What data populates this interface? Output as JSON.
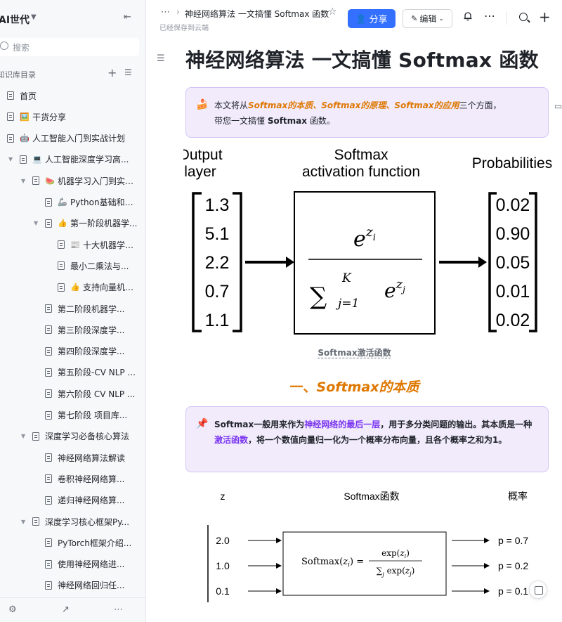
{
  "sidebar": {
    "title": "AI世代",
    "search_placeholder": "搜索",
    "section_label": "知识库目录",
    "items": [
      {
        "label": "首页",
        "emoji": ""
      },
      {
        "label": "干货分享",
        "emoji": "🖼️"
      },
      {
        "label": "人工智能入门到实战计划",
        "emoji": "🤖"
      },
      {
        "label": "人工智能深度学习高...",
        "emoji": "💻"
      },
      {
        "label": "机器学习入门到实战...",
        "emoji": "🍉"
      },
      {
        "label": "Python基础和数...",
        "emoji": "🦾"
      },
      {
        "label": "第一阶段机器学...",
        "emoji": "👍"
      },
      {
        "label": "十大机器学习...",
        "emoji": "📰"
      },
      {
        "label": "最小二乘法与...",
        "emoji": ""
      },
      {
        "label": "支持向量机算...",
        "emoji": "👍"
      },
      {
        "label": "第二阶段机器学...",
        "emoji": ""
      },
      {
        "label": "第三阶段深度学...",
        "emoji": ""
      },
      {
        "label": "第四阶段深度学...",
        "emoji": ""
      },
      {
        "label": "第五阶段-CV NLP ...",
        "emoji": ""
      },
      {
        "label": "第六阶段 CV NLP ...",
        "emoji": ""
      },
      {
        "label": "第七阶段 项目库...",
        "emoji": ""
      },
      {
        "label": "深度学习必备核心算法",
        "emoji": ""
      },
      {
        "label": "神经网络算法解读",
        "emoji": ""
      },
      {
        "label": "卷积神经网络算...",
        "emoji": ""
      },
      {
        "label": "递归神经网络算...",
        "emoji": ""
      },
      {
        "label": "深度学习核心框架Py...",
        "emoji": ""
      },
      {
        "label": "PyTorch框架介绍...",
        "emoji": ""
      },
      {
        "label": "使用神经网络进...",
        "emoji": ""
      },
      {
        "label": "神经网络回归任...",
        "emoji": ""
      }
    ]
  },
  "topbar": {
    "breadcrumb_title": "神经网络算法 一文搞懂 Softmax 函数",
    "saved_status": "已经保存到云端",
    "share_label": "分享",
    "edit_label": "编辑"
  },
  "doc": {
    "title": "神经网络算法 一文搞懂 Softmax 函数",
    "callout1": {
      "icon": "🍰",
      "pre": "本文将从",
      "highlight": "Softmax的本质、Softmax的原理、Softmax的应用",
      "post": "三个方面，",
      "line2_pre": "带您一文搞懂 ",
      "line2_bold": "Softmax",
      "line2_post": " 函数。"
    },
    "figure1": {
      "left_title_1": "Output",
      "left_title_2": "layer",
      "mid_title_1": "Softmax",
      "mid_title_2": "activation function",
      "right_title": "Probabilities",
      "inputs": [
        "1.3",
        "5.1",
        "2.2",
        "0.7",
        "1.1"
      ],
      "outputs": [
        "0.02",
        "0.90",
        "0.05",
        "0.01",
        "0.02"
      ]
    },
    "figure1_caption": "Softmax激活函数",
    "heading1_prefix": "一、",
    "heading1_main": "Softmax的本质",
    "callout2": {
      "icon": "📌",
      "p1": "Softmax一般用来作为",
      "p1_link": "神经网络的最后一层",
      "p2": "，用于多分类问题的输出。其本质是一种",
      "p2_link": "激活函数",
      "p3": "，将一个数值向量归一化为一个概率分布向量，且各个概率之和为1。"
    },
    "figure2": {
      "col_z": "z",
      "col_mid": "Softmax函数",
      "col_prob": "概率",
      "z_values": [
        "2.0",
        "1.0",
        "0.1"
      ],
      "probs": [
        "p = 0.7",
        "p = 0.2",
        "p = 0.1"
      ]
    }
  },
  "colors": {
    "accent": "#3370ff",
    "callout_bg": "#f1ebfc",
    "heading_orange": "#de7802",
    "link_purple": "#7a35f0"
  }
}
